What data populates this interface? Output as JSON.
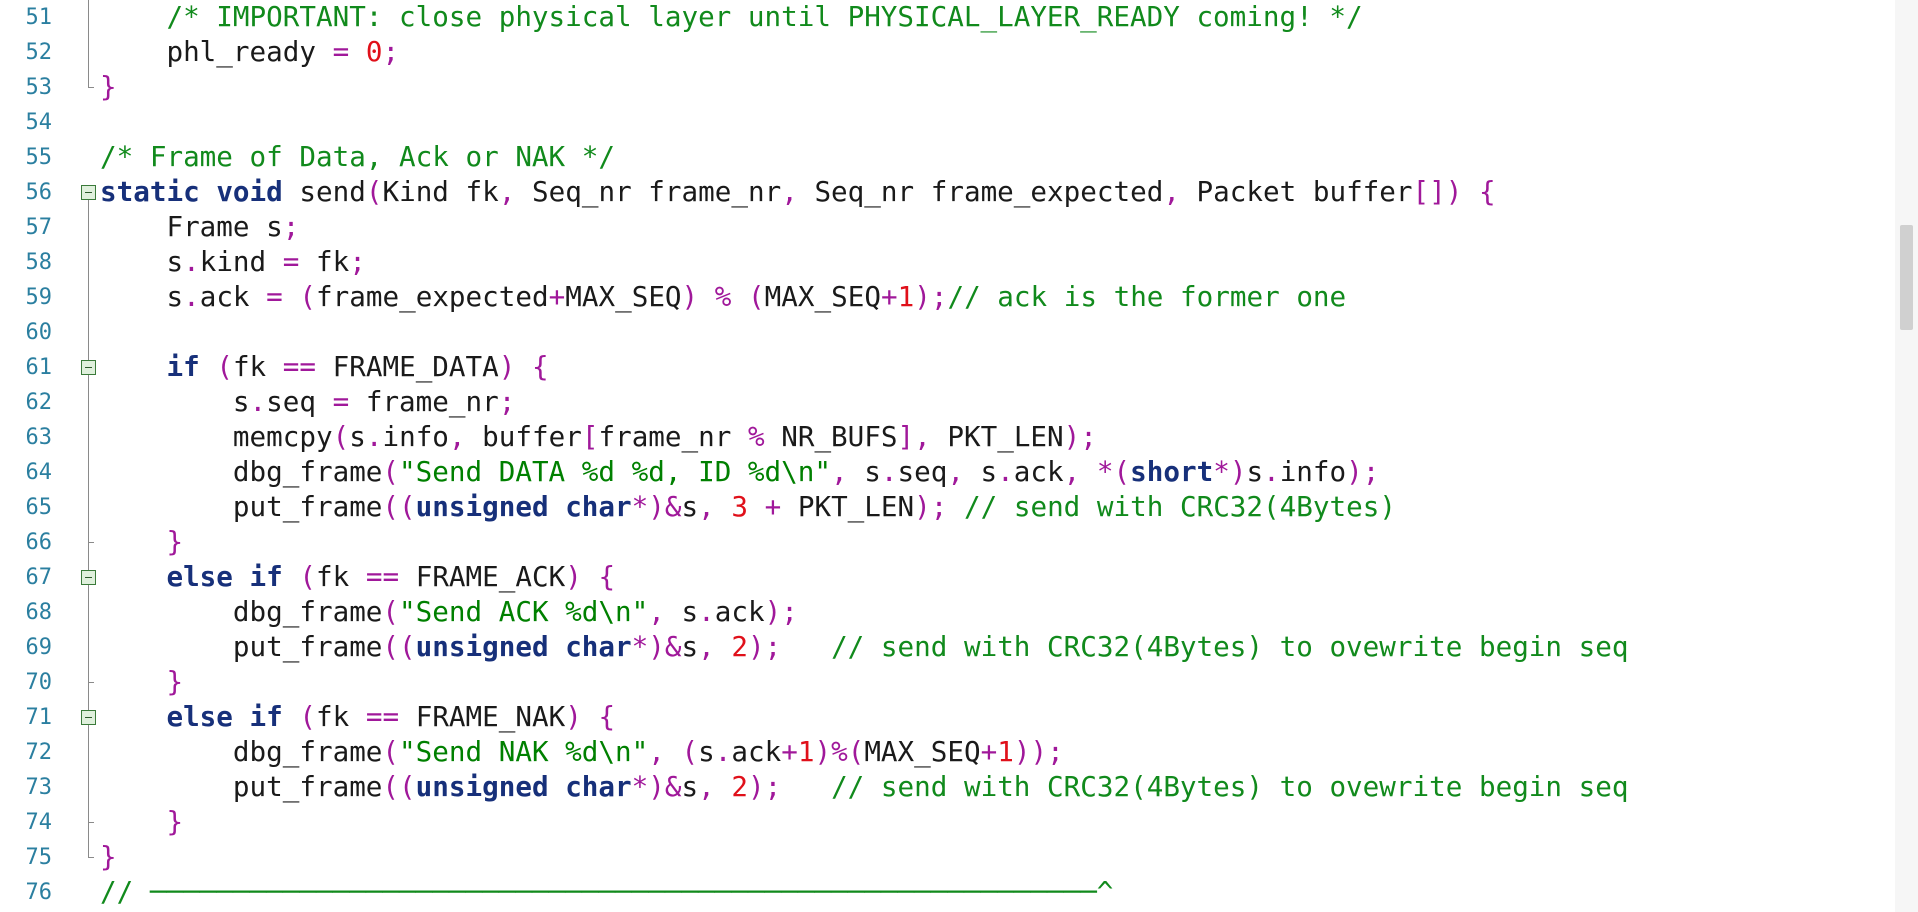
{
  "editor": {
    "lines": [
      {
        "number": "51",
        "fold": "line",
        "tokens": [
          {
            "t": "    ",
            "k": "plain"
          },
          {
            "t": "/* IMPORTANT: close physical layer until PHYSICAL_LAYER_READY coming! */",
            "k": "comment"
          }
        ]
      },
      {
        "number": "52",
        "fold": "line",
        "tokens": [
          {
            "t": "    phl_ready ",
            "k": "plain"
          },
          {
            "t": "=",
            "k": "op"
          },
          {
            "t": " ",
            "k": "plain"
          },
          {
            "t": "0",
            "k": "num"
          },
          {
            "t": ";",
            "k": "op"
          }
        ]
      },
      {
        "number": "53",
        "fold": "end",
        "tokens": [
          {
            "t": "}",
            "k": "op"
          }
        ]
      },
      {
        "number": "54",
        "fold": "none",
        "tokens": []
      },
      {
        "number": "55",
        "fold": "none",
        "tokens": [
          {
            "t": "/* Frame of Data, Ack or NAK */",
            "k": "comment"
          }
        ]
      },
      {
        "number": "56",
        "fold": "open",
        "tokens": [
          {
            "t": "static",
            "k": "kw"
          },
          {
            "t": " ",
            "k": "plain"
          },
          {
            "t": "void",
            "k": "kw"
          },
          {
            "t": " send",
            "k": "plain"
          },
          {
            "t": "(",
            "k": "op"
          },
          {
            "t": "Kind fk",
            "k": "plain"
          },
          {
            "t": ",",
            "k": "op"
          },
          {
            "t": " Seq_nr frame_nr",
            "k": "plain"
          },
          {
            "t": ",",
            "k": "op"
          },
          {
            "t": " Seq_nr frame_expected",
            "k": "plain"
          },
          {
            "t": ",",
            "k": "op"
          },
          {
            "t": " Packet buffer",
            "k": "plain"
          },
          {
            "t": "[])",
            "k": "op"
          },
          {
            "t": " ",
            "k": "plain"
          },
          {
            "t": "{",
            "k": "op"
          }
        ]
      },
      {
        "number": "57",
        "fold": "line",
        "tokens": [
          {
            "t": "    Frame s",
            "k": "plain"
          },
          {
            "t": ";",
            "k": "op"
          }
        ]
      },
      {
        "number": "58",
        "fold": "line",
        "tokens": [
          {
            "t": "    s",
            "k": "plain"
          },
          {
            "t": ".",
            "k": "op"
          },
          {
            "t": "kind ",
            "k": "plain"
          },
          {
            "t": "=",
            "k": "op"
          },
          {
            "t": " fk",
            "k": "plain"
          },
          {
            "t": ";",
            "k": "op"
          }
        ]
      },
      {
        "number": "59",
        "fold": "line",
        "tokens": [
          {
            "t": "    s",
            "k": "plain"
          },
          {
            "t": ".",
            "k": "op"
          },
          {
            "t": "ack ",
            "k": "plain"
          },
          {
            "t": "=",
            "k": "op"
          },
          {
            "t": " ",
            "k": "plain"
          },
          {
            "t": "(",
            "k": "op"
          },
          {
            "t": "frame_expected",
            "k": "plain"
          },
          {
            "t": "+",
            "k": "op"
          },
          {
            "t": "MAX_SEQ",
            "k": "plain"
          },
          {
            "t": ")",
            "k": "op"
          },
          {
            "t": " ",
            "k": "plain"
          },
          {
            "t": "%",
            "k": "op"
          },
          {
            "t": " ",
            "k": "plain"
          },
          {
            "t": "(",
            "k": "op"
          },
          {
            "t": "MAX_SEQ",
            "k": "plain"
          },
          {
            "t": "+",
            "k": "op"
          },
          {
            "t": "1",
            "k": "num"
          },
          {
            "t": ");",
            "k": "op"
          },
          {
            "t": "// ack is the former one",
            "k": "comment"
          }
        ]
      },
      {
        "number": "60",
        "fold": "line",
        "tokens": []
      },
      {
        "number": "61",
        "fold": "open",
        "tokens": [
          {
            "t": "    ",
            "k": "plain"
          },
          {
            "t": "if",
            "k": "kw"
          },
          {
            "t": " ",
            "k": "plain"
          },
          {
            "t": "(",
            "k": "op"
          },
          {
            "t": "fk ",
            "k": "plain"
          },
          {
            "t": "==",
            "k": "op"
          },
          {
            "t": " FRAME_DATA",
            "k": "plain"
          },
          {
            "t": ")",
            "k": "op"
          },
          {
            "t": " ",
            "k": "plain"
          },
          {
            "t": "{",
            "k": "op"
          }
        ]
      },
      {
        "number": "62",
        "fold": "line",
        "tokens": [
          {
            "t": "        s",
            "k": "plain"
          },
          {
            "t": ".",
            "k": "op"
          },
          {
            "t": "seq ",
            "k": "plain"
          },
          {
            "t": "=",
            "k": "op"
          },
          {
            "t": " frame_nr",
            "k": "plain"
          },
          {
            "t": ";",
            "k": "op"
          }
        ]
      },
      {
        "number": "63",
        "fold": "line",
        "tokens": [
          {
            "t": "        memcpy",
            "k": "plain"
          },
          {
            "t": "(",
            "k": "op"
          },
          {
            "t": "s",
            "k": "plain"
          },
          {
            "t": ".",
            "k": "op"
          },
          {
            "t": "info",
            "k": "plain"
          },
          {
            "t": ",",
            "k": "op"
          },
          {
            "t": " buffer",
            "k": "plain"
          },
          {
            "t": "[",
            "k": "op"
          },
          {
            "t": "frame_nr ",
            "k": "plain"
          },
          {
            "t": "%",
            "k": "op"
          },
          {
            "t": " NR_BUFS",
            "k": "plain"
          },
          {
            "t": "],",
            "k": "op"
          },
          {
            "t": " PKT_LEN",
            "k": "plain"
          },
          {
            "t": ");",
            "k": "op"
          }
        ]
      },
      {
        "number": "64",
        "fold": "line",
        "tokens": [
          {
            "t": "        dbg_frame",
            "k": "plain"
          },
          {
            "t": "(",
            "k": "op"
          },
          {
            "t": "\"Send DATA %d %d, ID %d\\n\"",
            "k": "str"
          },
          {
            "t": ",",
            "k": "op"
          },
          {
            "t": " s",
            "k": "plain"
          },
          {
            "t": ".",
            "k": "op"
          },
          {
            "t": "seq",
            "k": "plain"
          },
          {
            "t": ",",
            "k": "op"
          },
          {
            "t": " s",
            "k": "plain"
          },
          {
            "t": ".",
            "k": "op"
          },
          {
            "t": "ack",
            "k": "plain"
          },
          {
            "t": ",",
            "k": "op"
          },
          {
            "t": " ",
            "k": "plain"
          },
          {
            "t": "*(",
            "k": "op"
          },
          {
            "t": "short",
            "k": "kw"
          },
          {
            "t": "*)",
            "k": "op"
          },
          {
            "t": "s",
            "k": "plain"
          },
          {
            "t": ".",
            "k": "op"
          },
          {
            "t": "info",
            "k": "plain"
          },
          {
            "t": ");",
            "k": "op"
          }
        ]
      },
      {
        "number": "65",
        "fold": "line",
        "tokens": [
          {
            "t": "        put_frame",
            "k": "plain"
          },
          {
            "t": "((",
            "k": "op"
          },
          {
            "t": "unsigned",
            "k": "kw"
          },
          {
            "t": " ",
            "k": "plain"
          },
          {
            "t": "char",
            "k": "kw"
          },
          {
            "t": "*)&",
            "k": "op"
          },
          {
            "t": "s",
            "k": "plain"
          },
          {
            "t": ",",
            "k": "op"
          },
          {
            "t": " ",
            "k": "plain"
          },
          {
            "t": "3",
            "k": "num"
          },
          {
            "t": " ",
            "k": "plain"
          },
          {
            "t": "+",
            "k": "op"
          },
          {
            "t": " PKT_LEN",
            "k": "plain"
          },
          {
            "t": ");",
            "k": "op"
          },
          {
            "t": " ",
            "k": "plain"
          },
          {
            "t": "// send with CRC32(4Bytes)",
            "k": "comment"
          }
        ]
      },
      {
        "number": "66",
        "fold": "end-mid",
        "tokens": [
          {
            "t": "    ",
            "k": "plain"
          },
          {
            "t": "}",
            "k": "op"
          }
        ]
      },
      {
        "number": "67",
        "fold": "open",
        "tokens": [
          {
            "t": "    ",
            "k": "plain"
          },
          {
            "t": "else",
            "k": "kw"
          },
          {
            "t": " ",
            "k": "plain"
          },
          {
            "t": "if",
            "k": "kw"
          },
          {
            "t": " ",
            "k": "plain"
          },
          {
            "t": "(",
            "k": "op"
          },
          {
            "t": "fk ",
            "k": "plain"
          },
          {
            "t": "==",
            "k": "op"
          },
          {
            "t": " FRAME_ACK",
            "k": "plain"
          },
          {
            "t": ")",
            "k": "op"
          },
          {
            "t": " ",
            "k": "plain"
          },
          {
            "t": "{",
            "k": "op"
          }
        ]
      },
      {
        "number": "68",
        "fold": "line",
        "tokens": [
          {
            "t": "        dbg_frame",
            "k": "plain"
          },
          {
            "t": "(",
            "k": "op"
          },
          {
            "t": "\"Send ACK %d\\n\"",
            "k": "str"
          },
          {
            "t": ",",
            "k": "op"
          },
          {
            "t": " s",
            "k": "plain"
          },
          {
            "t": ".",
            "k": "op"
          },
          {
            "t": "ack",
            "k": "plain"
          },
          {
            "t": ");",
            "k": "op"
          }
        ]
      },
      {
        "number": "69",
        "fold": "line",
        "tokens": [
          {
            "t": "        put_frame",
            "k": "plain"
          },
          {
            "t": "((",
            "k": "op"
          },
          {
            "t": "unsigned",
            "k": "kw"
          },
          {
            "t": " ",
            "k": "plain"
          },
          {
            "t": "char",
            "k": "kw"
          },
          {
            "t": "*)&",
            "k": "op"
          },
          {
            "t": "s",
            "k": "plain"
          },
          {
            "t": ",",
            "k": "op"
          },
          {
            "t": " ",
            "k": "plain"
          },
          {
            "t": "2",
            "k": "num"
          },
          {
            "t": ");",
            "k": "op"
          },
          {
            "t": "   ",
            "k": "plain"
          },
          {
            "t": "// send with CRC32(4Bytes) to ovewrite begin seq",
            "k": "comment"
          }
        ]
      },
      {
        "number": "70",
        "fold": "end-mid",
        "tokens": [
          {
            "t": "    ",
            "k": "plain"
          },
          {
            "t": "}",
            "k": "op"
          }
        ]
      },
      {
        "number": "71",
        "fold": "open",
        "tokens": [
          {
            "t": "    ",
            "k": "plain"
          },
          {
            "t": "else",
            "k": "kw"
          },
          {
            "t": " ",
            "k": "plain"
          },
          {
            "t": "if",
            "k": "kw"
          },
          {
            "t": " ",
            "k": "plain"
          },
          {
            "t": "(",
            "k": "op"
          },
          {
            "t": "fk ",
            "k": "plain"
          },
          {
            "t": "==",
            "k": "op"
          },
          {
            "t": " FRAME_NAK",
            "k": "plain"
          },
          {
            "t": ")",
            "k": "op"
          },
          {
            "t": " ",
            "k": "plain"
          },
          {
            "t": "{",
            "k": "op"
          }
        ]
      },
      {
        "number": "72",
        "fold": "line",
        "tokens": [
          {
            "t": "        dbg_frame",
            "k": "plain"
          },
          {
            "t": "(",
            "k": "op"
          },
          {
            "t": "\"Send NAK %d\\n\"",
            "k": "str"
          },
          {
            "t": ",",
            "k": "op"
          },
          {
            "t": " ",
            "k": "plain"
          },
          {
            "t": "(",
            "k": "op"
          },
          {
            "t": "s",
            "k": "plain"
          },
          {
            "t": ".",
            "k": "op"
          },
          {
            "t": "ack",
            "k": "plain"
          },
          {
            "t": "+",
            "k": "op"
          },
          {
            "t": "1",
            "k": "num"
          },
          {
            "t": ")%(",
            "k": "op"
          },
          {
            "t": "MAX_SEQ",
            "k": "plain"
          },
          {
            "t": "+",
            "k": "op"
          },
          {
            "t": "1",
            "k": "num"
          },
          {
            "t": "));",
            "k": "op"
          }
        ]
      },
      {
        "number": "73",
        "fold": "line",
        "tokens": [
          {
            "t": "        put_frame",
            "k": "plain"
          },
          {
            "t": "((",
            "k": "op"
          },
          {
            "t": "unsigned",
            "k": "kw"
          },
          {
            "t": " ",
            "k": "plain"
          },
          {
            "t": "char",
            "k": "kw"
          },
          {
            "t": "*)&",
            "k": "op"
          },
          {
            "t": "s",
            "k": "plain"
          },
          {
            "t": ",",
            "k": "op"
          },
          {
            "t": " ",
            "k": "plain"
          },
          {
            "t": "2",
            "k": "num"
          },
          {
            "t": ");",
            "k": "op"
          },
          {
            "t": "   ",
            "k": "plain"
          },
          {
            "t": "// send with CRC32(4Bytes) to ovewrite begin seq",
            "k": "comment"
          }
        ]
      },
      {
        "number": "74",
        "fold": "end-mid",
        "tokens": [
          {
            "t": "    ",
            "k": "plain"
          },
          {
            "t": "}",
            "k": "op"
          }
        ]
      },
      {
        "number": "75",
        "fold": "end",
        "tokens": [
          {
            "t": "}",
            "k": "op"
          }
        ]
      },
      {
        "number": "76",
        "fold": "none",
        "tokens": [
          {
            "t": "// ─────────────────────────────────────────────────────────^",
            "k": "comment"
          }
        ]
      }
    ]
  },
  "colors": {
    "line_number": "#2b7fa0",
    "plain": "#1a1a1a",
    "keyword": "#17307a",
    "operator": "#a0189a",
    "number": "#e0101a",
    "string": "#008000",
    "comment": "#118a1c",
    "fold_box": "#dff0dc"
  }
}
